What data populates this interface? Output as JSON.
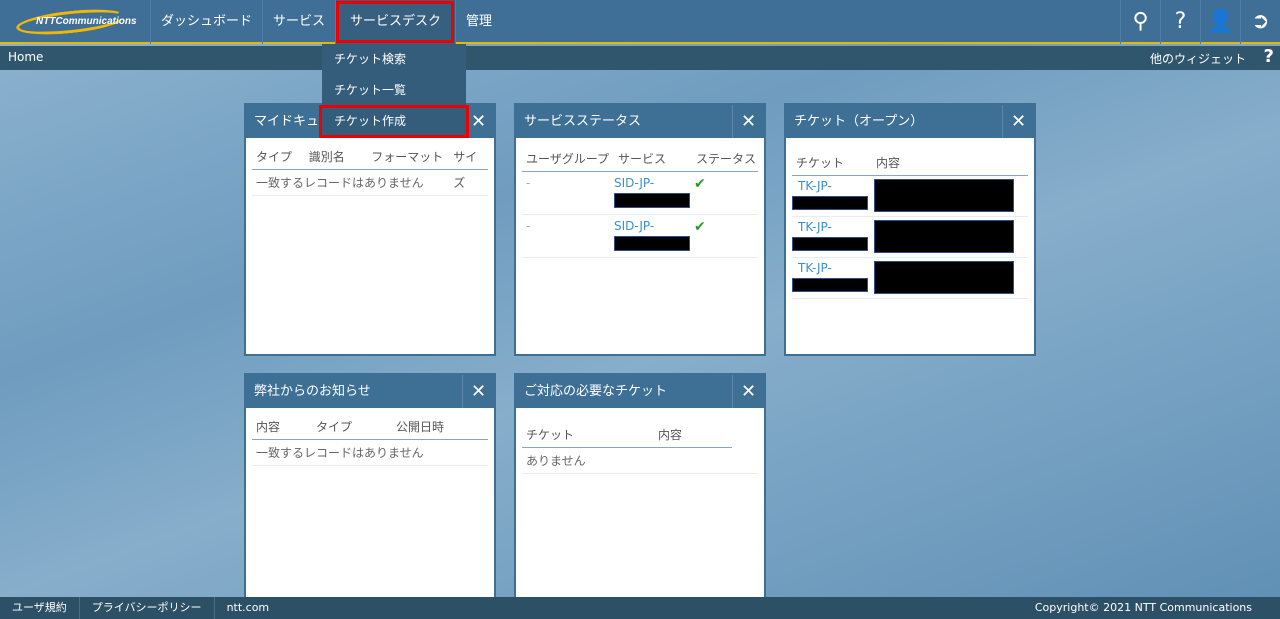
{
  "header": {
    "logo": "NTTCommunications",
    "nav": [
      "ダッシュボード",
      "サービス",
      "サービスデスク",
      "管理"
    ],
    "icons": [
      "search-icon",
      "help-icon",
      "user-icon",
      "logout-icon"
    ]
  },
  "subbar": {
    "breadcrumb": "Home",
    "other_widgets": "他のウィジェット",
    "help": "?"
  },
  "dropdown": [
    "チケット検索",
    "チケット一覧",
    "チケット作成"
  ],
  "widgets": {
    "mydoc": {
      "title": "マイドキュメント",
      "cols": [
        "タイプ",
        "識別名",
        "フォーマット",
        "サイズ"
      ],
      "empty": "一致するレコードはありません"
    },
    "status": {
      "title": "サービスステータス",
      "cols": [
        "ユーザグループ",
        "サービス",
        "ステータス"
      ],
      "rows": [
        {
          "group": "-",
          "service": "SID-JP-"
        },
        {
          "group": "-",
          "service": "SID-JP-"
        }
      ]
    },
    "open": {
      "title": "チケット（オープン）",
      "cols": [
        "チケット",
        "内容"
      ],
      "rows": [
        "TK-JP-",
        "TK-JP-",
        "TK-JP-"
      ]
    },
    "news": {
      "title": "弊社からのお知らせ",
      "cols": [
        "内容",
        "タイプ",
        "公開日時"
      ],
      "empty": "一致するレコードはありません"
    },
    "action": {
      "title": "ご対応の必要なチケット",
      "cols": [
        "チケット",
        "内容"
      ],
      "empty": "ありません"
    }
  },
  "footer": {
    "links": [
      "ユーザ規約",
      "プライバシーポリシー",
      "ntt.com"
    ],
    "copyright": "Copyright© 2021 NTT Communications"
  }
}
